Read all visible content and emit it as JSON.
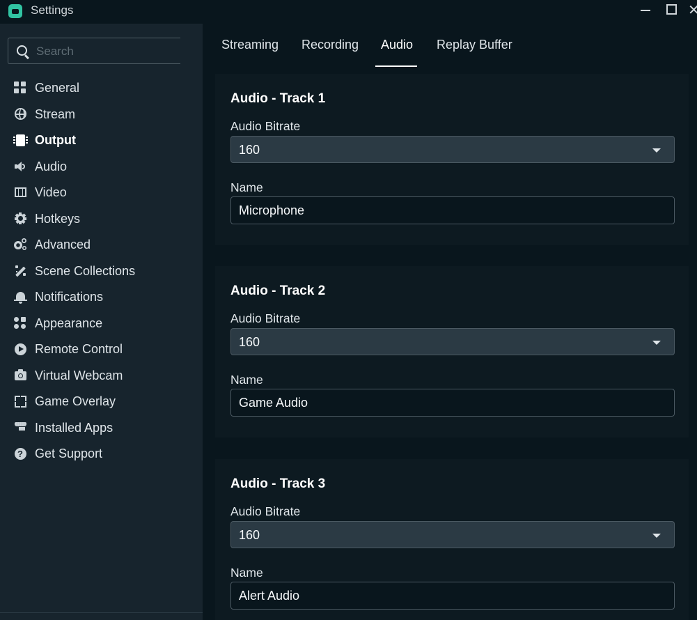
{
  "window": {
    "title": "Settings",
    "minimize_icon": "minimize-icon",
    "maximize_icon": "maximize-icon",
    "close_glyph": "✕"
  },
  "search": {
    "placeholder": "Search",
    "value": ""
  },
  "sidebar": {
    "items": [
      {
        "label": "General",
        "icon": "grid-icon",
        "active": false
      },
      {
        "label": "Stream",
        "icon": "globe-icon",
        "active": false
      },
      {
        "label": "Output",
        "icon": "chip-icon",
        "active": true
      },
      {
        "label": "Audio",
        "icon": "speaker-icon",
        "active": false
      },
      {
        "label": "Video",
        "icon": "film-icon",
        "active": false
      },
      {
        "label": "Hotkeys",
        "icon": "gear-icon",
        "active": false
      },
      {
        "label": "Advanced",
        "icon": "gears-icon",
        "active": false
      },
      {
        "label": "Scene Collections",
        "icon": "magic-wand-icon",
        "active": false
      },
      {
        "label": "Notifications",
        "icon": "bell-icon",
        "active": false
      },
      {
        "label": "Appearance",
        "icon": "palette-icon",
        "active": false
      },
      {
        "label": "Remote Control",
        "icon": "play-circle-icon",
        "active": false
      },
      {
        "label": "Virtual Webcam",
        "icon": "camera-icon",
        "active": false
      },
      {
        "label": "Game Overlay",
        "icon": "expand-icon",
        "active": false
      },
      {
        "label": "Installed Apps",
        "icon": "store-icon",
        "active": false
      },
      {
        "label": "Get Support",
        "icon": "help-icon",
        "active": false
      }
    ]
  },
  "tabs": [
    {
      "label": "Streaming",
      "active": false
    },
    {
      "label": "Recording",
      "active": false
    },
    {
      "label": "Audio",
      "active": true
    },
    {
      "label": "Replay Buffer",
      "active": false
    }
  ],
  "tracks": [
    {
      "title": "Audio - Track 1",
      "bitrate_label": "Audio Bitrate",
      "bitrate": "160",
      "name_label": "Name",
      "name": "Microphone"
    },
    {
      "title": "Audio - Track 2",
      "bitrate_label": "Audio Bitrate",
      "bitrate": "160",
      "name_label": "Name",
      "name": "Game Audio"
    },
    {
      "title": "Audio - Track 3",
      "bitrate_label": "Audio Bitrate",
      "bitrate": "160",
      "name_label": "Name",
      "name": "Alert Audio"
    }
  ],
  "colors": {
    "background": "#09161d",
    "sidebar": "#17242d",
    "card": "#0d1a21",
    "select": "#2b3a44",
    "accent": "#31c3a2"
  }
}
